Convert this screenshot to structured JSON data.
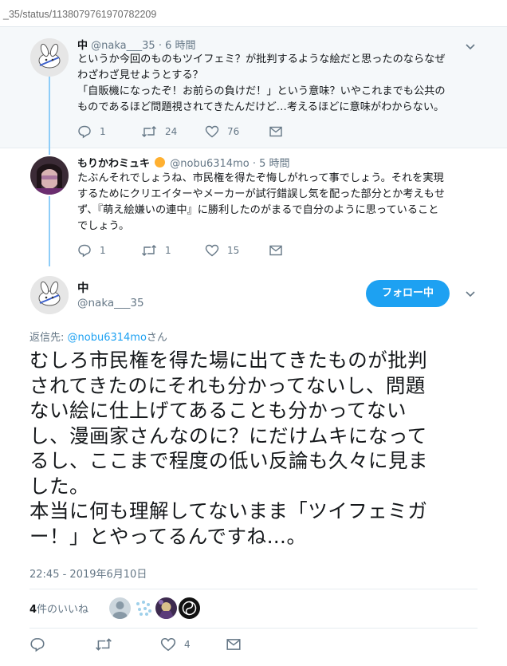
{
  "browser": {
    "url": "_35/status/1138079761970782209"
  },
  "thread": [
    {
      "author": {
        "name": "中",
        "handle": "@naka___35",
        "time": "6 時間"
      },
      "separator": "·",
      "lines": [
        "というか今回のものもツイフェミ？が批判するような絵だと思ったのならなぜ",
        "わざわざ見せようとする？",
        "「自販機になったぞ！お前らの負けだ！」という意味？いやこれまでも公共の",
        "ものであるほど問題視されてきたんだけど…考えるほどに意味がわからない。"
      ],
      "stats": {
        "replies": "1",
        "retweets": "24",
        "likes": "76"
      }
    },
    {
      "author": {
        "name": "もりかわミュキ",
        "handle": "@nobu6314mo",
        "time": "5 時間"
      },
      "separator": "·",
      "lines": [
        "たぶんそれでしょうね、市民権を得たぞ悔しがれって事でしょう。それを実現",
        "するためにクリエイターやメーカーが試行錯誤し気を配った部分とか考えもせ",
        "ず、『萌え絵嫌いの連中』に勝利したのがまるで自分のように思っていること",
        "でしょう。"
      ],
      "stats": {
        "replies": "1",
        "retweets": "1",
        "likes": "15"
      }
    }
  ],
  "main": {
    "name": "中",
    "handle": "@naka___35",
    "follow_label": "フォロー中",
    "reply_prefix": "返信先: ",
    "reply_mention": "@nobu6314mo",
    "reply_suffix": "さん",
    "lines": [
      "むしろ市民権を得た場に出てきたものが批判",
      "されてきたのにそれも分かってないし、問題",
      "ない絵に仕上げてあることも分かってない",
      "し、漫画家さんなのに？にだけムキになって",
      "るし、ここまで程度の低い反論も久々に見ま",
      "した。",
      "本当に何も理解してないまま「ツイフェミガ",
      "ー！」とやってるんですね…。"
    ],
    "timestamp": "22:45 - 2019年6月10日",
    "likes_count": "4",
    "likes_label": "件のいいね",
    "stats": {
      "likes": "4"
    }
  },
  "colors": {
    "accent": "#1da1f2",
    "thread_line": "#8ecdf8",
    "muted": "#657786"
  }
}
